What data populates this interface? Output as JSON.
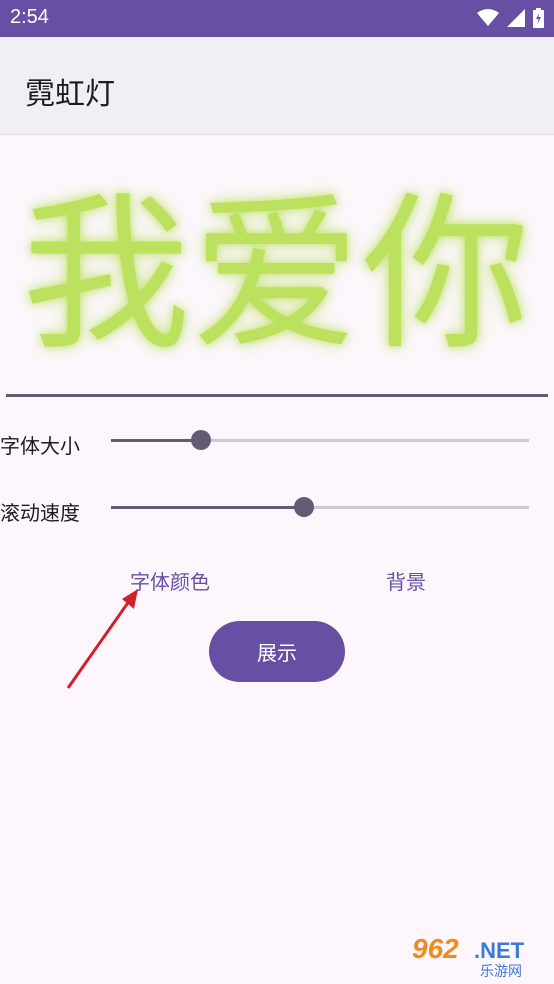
{
  "status_bar": {
    "time": "2:54",
    "icons": [
      "wifi-icon",
      "signal-icon",
      "battery-icon"
    ],
    "color": "#6750a4"
  },
  "app_bar": {
    "title": "霓虹灯"
  },
  "display": {
    "text": "我爱你",
    "color": "#bce15f"
  },
  "sliders": [
    {
      "label": "字体大小",
      "value": 0.215
    },
    {
      "label": "滚动速度",
      "value": 0.462
    }
  ],
  "buttons": {
    "font_color": "字体颜色",
    "background": "背景",
    "show": "展示"
  },
  "watermark": {
    "main": "962.NET",
    "sub": "乐游网"
  }
}
